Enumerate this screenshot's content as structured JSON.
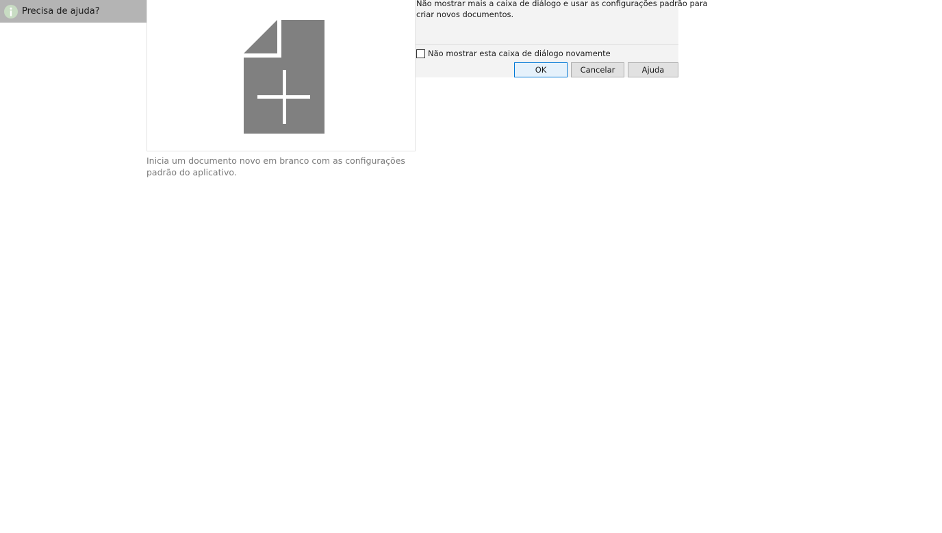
{
  "help": {
    "label": "Precisa de ajuda?",
    "icon": "info-icon"
  },
  "template": {
    "icon": "new-document-icon",
    "description": "Inicia um documento novo em branco com as configurações padrão do aplicativo."
  },
  "dialog": {
    "info_line1": "Não mostrar mais a caixa de diálogo e usar as configurações padrão para",
    "info_line2": "criar novos documentos.",
    "checkbox_label": "Não mostrar esta caixa de diálogo novamente",
    "checkbox_checked": false,
    "buttons": {
      "ok": "OK",
      "cancel": "Cancelar",
      "help": "Ajuda"
    }
  },
  "colors": {
    "icon_gray": "#808080",
    "ok_border": "#0078d7"
  }
}
